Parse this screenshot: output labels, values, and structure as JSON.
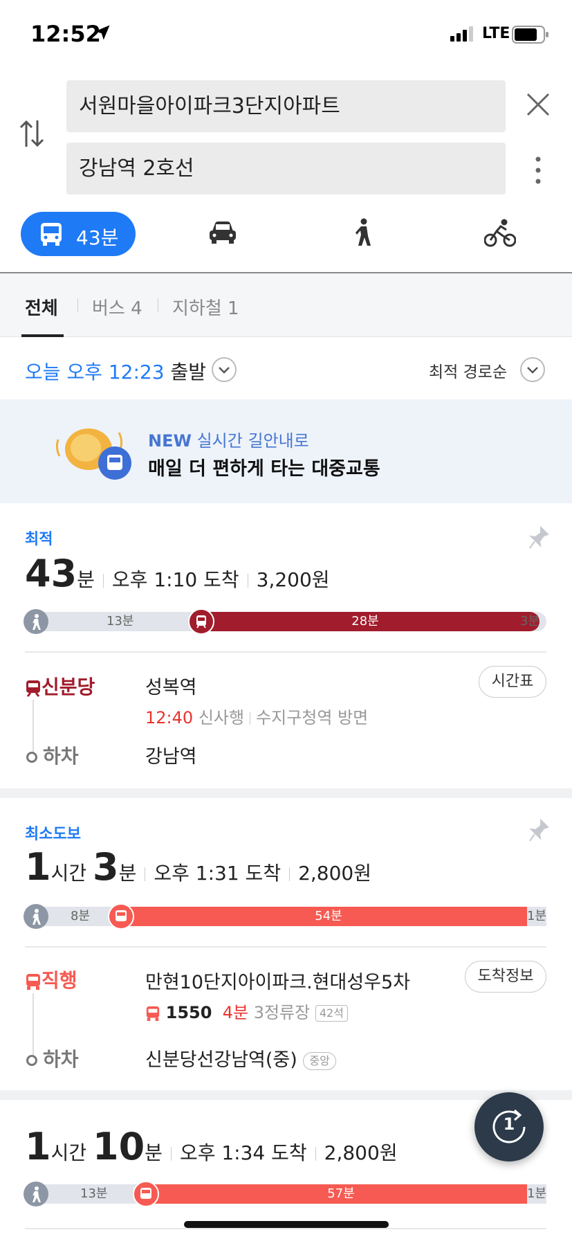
{
  "status_bar": {
    "time": "12:52",
    "network": "LTE"
  },
  "search": {
    "origin": "서원마을아이파크3단지아파트",
    "destination": "강남역 2호선"
  },
  "modes": {
    "bus_label": "43분"
  },
  "filters": {
    "all": "전체",
    "bus": "버스 4",
    "subway": "지하철 1"
  },
  "departure": {
    "time_text": "오늘 오후 12:23",
    "suffix": " 출발",
    "sort": "최적 경로순"
  },
  "banner": {
    "new": "NEW",
    "title": " 실시간 길안내로",
    "subtitle": "매일 더 편하게 타는 대중교통"
  },
  "routes": [
    {
      "tag": "최적",
      "duration_main": "43",
      "duration_unit": "분",
      "arrival": "오후 1:10 도착",
      "fare": "3,200원",
      "bar": {
        "walk_start": "13분",
        "ride": "28분",
        "walk_end": "3분",
        "ride_color": "#a11c2c",
        "ride_fraction": 0.65
      },
      "step_mode": "신분당",
      "step_mode_color": "#a11c2c",
      "board": "성복역",
      "sub_time": "12:40",
      "sub_dir": "신사행",
      "sub_next": "수지구청역 방면",
      "action": "시간표",
      "off_label": "하차",
      "off_stop": "강남역"
    },
    {
      "tag": "최소도보",
      "duration_h": "1",
      "duration_h_unit": "시간",
      "duration_m": "3",
      "duration_m_unit": "분",
      "arrival": "오후 1:31 도착",
      "fare": "2,800원",
      "bar": {
        "walk_start": "8분",
        "ride": "54분",
        "walk_end": "1분",
        "ride_color": "#f65a52",
        "ride_fraction": 0.86
      },
      "step_mode": "직행",
      "step_mode_color": "#f65a52",
      "board": "만현10단지아이파크.현대성우5차",
      "bus_no": "1550",
      "bus_wait": "4분",
      "bus_stops": "3정류장",
      "bus_seats": "42석",
      "action": "도착정보",
      "off_label": "하차",
      "off_stop": "신분당선강남역(중)",
      "off_badge": "중앙"
    },
    {
      "duration_h": "1",
      "duration_h_unit": "시간",
      "duration_m": "10",
      "duration_m_unit": "분",
      "arrival": "오후 1:34 도착",
      "fare": "2,800원",
      "bar": {
        "walk_start": "13분",
        "ride": "57분",
        "walk_end": "1분",
        "ride_color": "#f65a52",
        "ride_fraction": 0.8
      }
    }
  ],
  "fab": {
    "count": "1"
  }
}
